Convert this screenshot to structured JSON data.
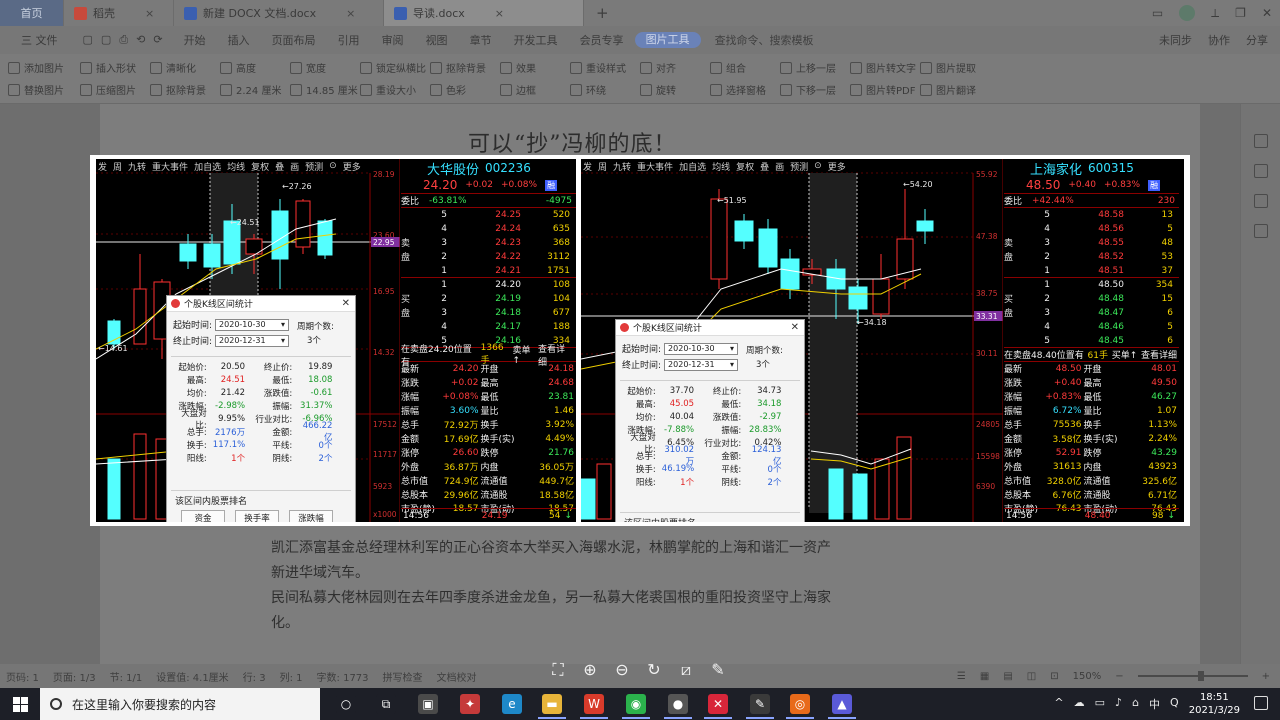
{
  "window": {
    "tabs": [
      {
        "label": "首页",
        "color": "#5a6a86"
      },
      {
        "label": "稻壳",
        "color": "#c74a3c"
      },
      {
        "label": "新建 DOCX 文档.docx",
        "color": "#3a5fb0"
      },
      {
        "label": "导读.docx",
        "color": "#3a5fb0"
      }
    ],
    "add_tab": "+"
  },
  "menu": {
    "items": [
      "三 文件",
      "开始",
      "插入",
      "页面布局",
      "引用",
      "审阅",
      "视图",
      "章节",
      "开发工具",
      "会员专享",
      "图片工具"
    ],
    "active": "图片工具",
    "search": "查找命令、搜索模板",
    "right_items": [
      "未同步",
      "协作",
      "分享"
    ]
  },
  "ribbon": {
    "items": [
      "添加图片",
      "替换图片",
      "插入形状",
      "压缩图片",
      "清晰化",
      "抠除背景",
      "高度",
      "2.24 厘米",
      "宽度",
      "14.85 厘米",
      "锁定纵横比",
      "重设大小",
      "抠除背景",
      "色彩",
      "效果",
      "边框",
      "重设样式",
      "环绕",
      "对齐",
      "旋转",
      "组合",
      "选择窗格",
      "上移一层",
      "下移一层",
      "图片转文字",
      "图片转PDF",
      "图片提取",
      "图片翻译"
    ]
  },
  "document": {
    "heading": "可以“抄”冯柳的底！",
    "paragraphs": [
      "凯汇添富基金总经理林利军的正心谷资本大举买入海螺水泥，林鹏掌舵的上海和谐汇一资产",
      "新进华域汽车。",
      "民间私募大佬林园则在去年四季度杀进金龙鱼，另一私募大佬裘国根的重阳投资坚守上海家",
      "化。"
    ]
  },
  "status": {
    "left": [
      "页码: 1",
      "页面: 1/3",
      "节: 1/1",
      "设置值: 4.1厘米",
      "行: 3",
      "列: 1",
      "字数: 1773",
      "拼写检查",
      "文档校对"
    ],
    "zoom": "150%"
  },
  "viewer_toolbar": [
    "fit-icon",
    "zoom-in-icon",
    "zoom-out-icon",
    "rotate-icon",
    "crop-icon",
    "edit-icon"
  ],
  "stocks": [
    {
      "id": "left",
      "name": "大华股份",
      "code": "002236",
      "price": "24.20",
      "change": "+0.02",
      "change_pct": "+0.08%",
      "badge": "融",
      "toolbar": [
        "发",
        "周",
        "九转",
        "重大事件",
        "加自选",
        "均线",
        "复权",
        "叠",
        "画",
        "预测",
        "⊙",
        "更多"
      ],
      "axis_labels": [
        "28.19",
        "23.60",
        "16.95",
        "14.32",
        "17512",
        "11717",
        "5923",
        "x1000"
      ],
      "price_tag": "22.95",
      "ratio": {
        "label": "委比",
        "value": "-63.81%",
        "diff": "-4975"
      },
      "asks": [
        {
          "lvl": "5",
          "price": "24.25",
          "vol": "520"
        },
        {
          "lvl": "4",
          "price": "24.24",
          "vol": "635"
        },
        {
          "lvl": "3",
          "price": "24.23",
          "vol": "368"
        },
        {
          "lvl": "2",
          "price": "24.22",
          "vol": "3112"
        },
        {
          "lvl": "1",
          "price": "24.21",
          "vol": "1751"
        }
      ],
      "bids": [
        {
          "lvl": "1",
          "price": "24.20",
          "vol": "108"
        },
        {
          "lvl": "2",
          "price": "24.19",
          "vol": "104"
        },
        {
          "lvl": "3",
          "price": "24.18",
          "vol": "677"
        },
        {
          "lvl": "4",
          "price": "24.17",
          "vol": "188"
        },
        {
          "lvl": "5",
          "price": "24.16",
          "vol": "334"
        }
      ],
      "ask_side": "卖盘",
      "bid_side": "买盘",
      "ticker_line": [
        "在卖盘24.20位置有",
        "1366手",
        "卖单↑",
        "查看详细"
      ],
      "stats": [
        [
          "最新",
          "24.20",
          "开盘",
          "24.18"
        ],
        [
          "涨跌",
          "+0.02",
          "最高",
          "24.68"
        ],
        [
          "涨幅",
          "+0.08%",
          "最低",
          "23.81"
        ],
        [
          "振幅",
          "3.60%",
          "量比",
          "1.46"
        ],
        [
          "总手",
          "72.92万",
          "换手",
          "3.92%"
        ],
        [
          "金额",
          "17.69亿",
          "换手(实)",
          "4.49%"
        ],
        [
          "涨停",
          "26.60",
          "跌停",
          "21.76"
        ],
        [
          "外盘",
          "36.87万",
          "内盘",
          "36.05万"
        ],
        [
          "总市值",
          "724.9亿",
          "流通值",
          "449.7亿"
        ],
        [
          "总股本",
          "29.96亿",
          "流通股",
          "18.58亿"
        ],
        [
          "市盈(静)",
          "18.57",
          "市盈(动)",
          "18.57"
        ]
      ],
      "footer": [
        "14:56",
        "24.19",
        "54",
        "↓"
      ],
      "candle_labels": [
        "27.26",
        "24.51",
        "14.61"
      ],
      "dialog": {
        "title": "个股K线区间统计",
        "start_label": "起始时间:",
        "start": "2020-10-30",
        "end_label": "终止时间:",
        "end": "2020-12-31",
        "period_label": "周期个数:",
        "period": "3个",
        "rows": [
          [
            "起始价:",
            "20.50",
            "终止价:",
            "19.89"
          ],
          [
            "最高:",
            "24.51",
            "最低:",
            "18.08"
          ],
          [
            "均价:",
            "21.42",
            "涨跌值:",
            "-0.61"
          ],
          [
            "涨跌幅:",
            "-2.98%",
            "振幅:",
            "31.37%"
          ],
          [
            "大盘对比:",
            "9.95%",
            "行业对比:",
            "-6.96%"
          ],
          [
            "总手:",
            "2176万",
            "金额:",
            "466.22亿"
          ],
          [
            "换手:",
            "117.1%",
            "平线:",
            "0个"
          ],
          [
            "阳线:",
            "1个",
            "阴线:",
            "2个"
          ]
        ],
        "rank_title": "该区间内股票排名",
        "buttons": [
          "资金",
          "换手率",
          "涨跌幅"
        ]
      }
    },
    {
      "id": "right",
      "name": "上海家化",
      "code": "600315",
      "price": "48.50",
      "change": "+0.40",
      "change_pct": "+0.83%",
      "badge": "融",
      "toolbar": [
        "发",
        "周",
        "九转",
        "重大事件",
        "加自选",
        "均线",
        "复权",
        "叠",
        "画",
        "预测",
        "⊙",
        "更多"
      ],
      "axis_labels": [
        "55.92",
        "47.38",
        "38.75",
        "30.11",
        "24805",
        "15598",
        "6390"
      ],
      "price_tag": "33.31",
      "ratio": {
        "label": "委比",
        "value": "+42.44%",
        "diff": "230"
      },
      "asks": [
        {
          "lvl": "5",
          "price": "48.58",
          "vol": "13"
        },
        {
          "lvl": "4",
          "price": "48.56",
          "vol": "5"
        },
        {
          "lvl": "3",
          "price": "48.55",
          "vol": "48"
        },
        {
          "lvl": "2",
          "price": "48.52",
          "vol": "53"
        },
        {
          "lvl": "1",
          "price": "48.51",
          "vol": "37"
        }
      ],
      "bids": [
        {
          "lvl": "1",
          "price": "48.50",
          "vol": "354"
        },
        {
          "lvl": "2",
          "price": "48.48",
          "vol": "15"
        },
        {
          "lvl": "3",
          "price": "48.47",
          "vol": "6"
        },
        {
          "lvl": "4",
          "price": "48.46",
          "vol": "5"
        },
        {
          "lvl": "5",
          "price": "48.45",
          "vol": "6"
        }
      ],
      "ask_side": "卖盘",
      "bid_side": "买盘",
      "ticker_line": [
        "在卖盘48.40位置有",
        "61手",
        "买单↑",
        "查看详细"
      ],
      "stats": [
        [
          "最新",
          "48.50",
          "开盘",
          "48.01"
        ],
        [
          "涨跌",
          "+0.40",
          "最高",
          "49.50"
        ],
        [
          "涨幅",
          "+0.83%",
          "最低",
          "46.27"
        ],
        [
          "振幅",
          "6.72%",
          "量比",
          "1.07"
        ],
        [
          "总手",
          "75536",
          "换手",
          "1.13%"
        ],
        [
          "金额",
          "3.58亿",
          "换手(实)",
          "2.24%"
        ],
        [
          "涨停",
          "52.91",
          "跌停",
          "43.29"
        ],
        [
          "外盘",
          "31613",
          "内盘",
          "43923"
        ],
        [
          "总市值",
          "328.0亿",
          "流通值",
          "325.6亿"
        ],
        [
          "总股本",
          "6.76亿",
          "流通股",
          "6.71亿"
        ],
        [
          "市盈(静)",
          "76.43",
          "市盈(动)",
          "76.43"
        ]
      ],
      "footer": [
        "14:56",
        "48.40",
        "98",
        "↓"
      ],
      "candle_labels": [
        "51.95",
        "54.20",
        "34.18"
      ],
      "dialog": {
        "title": "个股K线区间统计",
        "start_label": "起始时间:",
        "start": "2020-10-30",
        "end_label": "终止时间:",
        "end": "2020-12-31",
        "period_label": "周期个数:",
        "period": "3个",
        "rows": [
          [
            "起始价:",
            "37.70",
            "终止价:",
            "34.73"
          ],
          [
            "最高:",
            "45.05",
            "最低:",
            "34.18"
          ],
          [
            "均价:",
            "40.04",
            "涨跌值:",
            "-2.97"
          ],
          [
            "涨跌幅:",
            "-7.88%",
            "振幅:",
            "28.83%"
          ],
          [
            "大盘对比:",
            "6.45%",
            "行业对比:",
            "0.42%"
          ],
          [
            "总手:",
            "310.02万",
            "金额:",
            "124.13亿"
          ],
          [
            "换手:",
            "46.19%",
            "平线:",
            "0个"
          ],
          [
            "阳线:",
            "1个",
            "阴线:",
            "2个"
          ]
        ],
        "rank_title": "该区间内股票排名",
        "buttons": []
      }
    }
  ],
  "taskbar": {
    "search_placeholder": "在这里输入你要搜索的内容",
    "apps": [
      {
        "name": "cortana-icon",
        "color": "#1d1f27",
        "glyph": "○"
      },
      {
        "name": "task-view-icon",
        "color": "#1d1f27",
        "glyph": "⧉"
      },
      {
        "name": "store-icon",
        "color": "#4a4a4a",
        "glyph": "▣"
      },
      {
        "name": "game-icon",
        "color": "#c53a3a",
        "glyph": "✦"
      },
      {
        "name": "edge-icon",
        "color": "#1e88c8",
        "glyph": "e"
      },
      {
        "name": "explorer-icon",
        "color": "#e7b43a",
        "glyph": "▬"
      },
      {
        "name": "wps-icon",
        "color": "#d83b2b",
        "glyph": "W"
      },
      {
        "name": "wechat-icon",
        "color": "#2bb24c",
        "glyph": "◉"
      },
      {
        "name": "media-icon",
        "color": "#555",
        "glyph": "●"
      },
      {
        "name": "xmind-icon",
        "color": "#d8263a",
        "glyph": "✕"
      },
      {
        "name": "tool-icon",
        "color": "#3a3a3a",
        "glyph": "✎"
      },
      {
        "name": "browser-icon",
        "color": "#e86a1a",
        "glyph": "◎"
      },
      {
        "name": "photo-icon",
        "color": "#5a5ad8",
        "glyph": "▲"
      }
    ],
    "tray": [
      "^",
      "☁",
      "▭",
      "♪",
      "⌂",
      "中",
      "Q"
    ],
    "time": "18:51",
    "date": "2021/3/29"
  }
}
